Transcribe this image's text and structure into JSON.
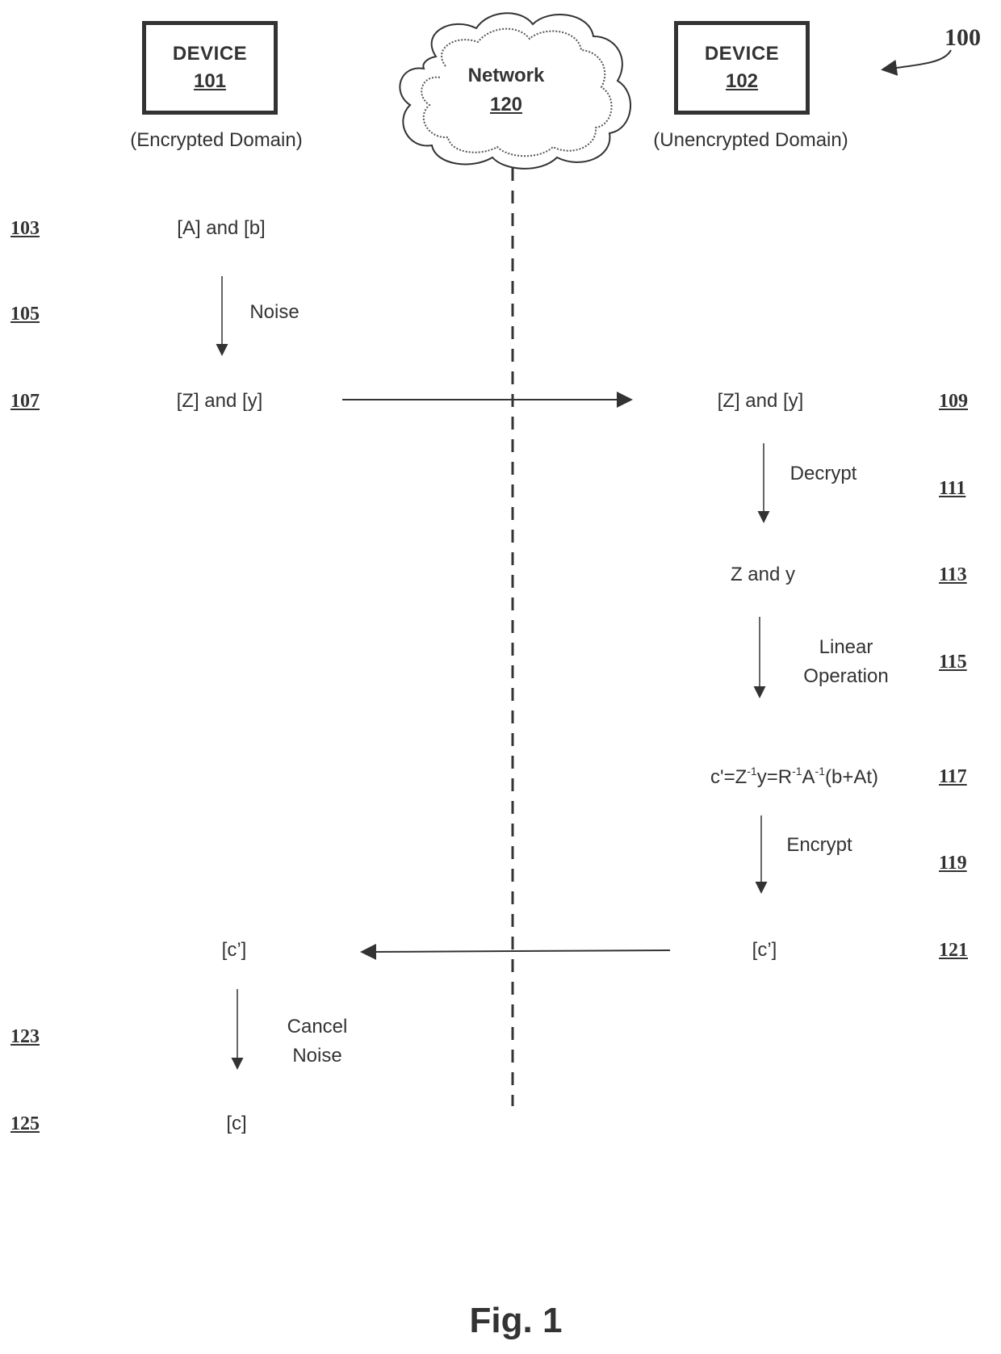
{
  "figure": {
    "reference": "100",
    "caption": "Fig. 1"
  },
  "devices": {
    "left": {
      "title": "DEVICE",
      "number": "101",
      "domain": "(Encrypted Domain)"
    },
    "right": {
      "title": "DEVICE",
      "number": "102",
      "domain": "(Unencrypted Domain)"
    }
  },
  "network": {
    "title": "Network",
    "number": "120"
  },
  "left_column": {
    "refs": [
      "103",
      "105",
      "107",
      "123",
      "125"
    ],
    "items": {
      "r103": "[A]  and  [b]",
      "r105": "Noise",
      "r107": "[Z]  and  [y]",
      "r121": "[c’]",
      "r123": "Cancel\nNoise",
      "r125": "[c]"
    }
  },
  "right_column": {
    "refs": [
      "109",
      "111",
      "113",
      "115",
      "117",
      "119",
      "121"
    ],
    "items": {
      "r109": "[Z]  and  [y]",
      "r111": "Decrypt",
      "r113": "Z  and  y",
      "r115": "Linear\nOperation",
      "r117": {
        "parts": [
          "c'=Z",
          "-1",
          "y=R",
          "-1",
          "A",
          "-1",
          "(b+At)"
        ]
      },
      "r119": "Encrypt",
      "r121": "[c’]"
    }
  }
}
